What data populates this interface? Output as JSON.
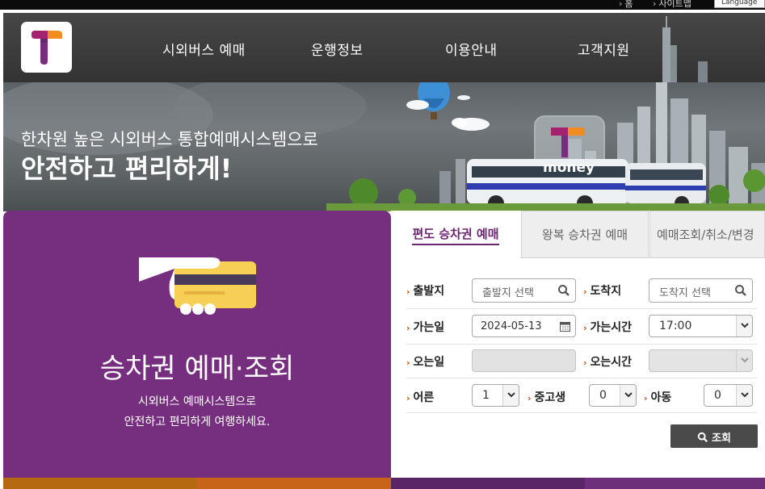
{
  "utility_bar": {
    "home_label": "홈",
    "sitemap_label": "사이트맵",
    "language_label": "Language"
  },
  "header": {
    "logo_icon": "tmoney-t-logo-icon",
    "nav": [
      {
        "label": "시외버스 예매"
      },
      {
        "label": "운행정보"
      },
      {
        "label": "이용안내"
      },
      {
        "label": "고객지원"
      }
    ]
  },
  "hero": {
    "line1": "한차원 높은 시외버스 통합예매시스템으로",
    "line2": "안전하고 편리하게!",
    "brand_text": "money"
  },
  "ticket_panel": {
    "icon": "card-in-hand-icon",
    "title": "승차권 예매·조회",
    "desc_line1": "시외버스 예매시스템으로",
    "desc_line2": "안전하고 편리하게 여행하세요."
  },
  "tabs": [
    {
      "label": "편도 승차권 예매",
      "active": true
    },
    {
      "label": "왕복 승차권 예매",
      "active": false
    },
    {
      "label": "예매조회/취소/변경",
      "active": false
    }
  ],
  "form": {
    "departure": {
      "label": "출발지",
      "placeholder": "출발지 선택"
    },
    "arrival": {
      "label": "도착지",
      "placeholder": "도착지 선택"
    },
    "go_date": {
      "label": "가는일",
      "value": "2024-05-13"
    },
    "go_time": {
      "label": "가는시간",
      "value": "17:00"
    },
    "return_date": {
      "label": "오는일",
      "value": ""
    },
    "return_time": {
      "label": "오는시간",
      "value": ""
    },
    "adult": {
      "label": "어른",
      "value": "1"
    },
    "teen": {
      "label": "중고생",
      "value": "0"
    },
    "child": {
      "label": "아동",
      "value": "0"
    },
    "search_button": "조회"
  },
  "colors": {
    "brand_purple": "#762f7e",
    "tab_active": "#6d2672",
    "label_marker": "#c24d08",
    "logo_orange": "#f08c20",
    "button_dark": "#4a4a4a"
  }
}
